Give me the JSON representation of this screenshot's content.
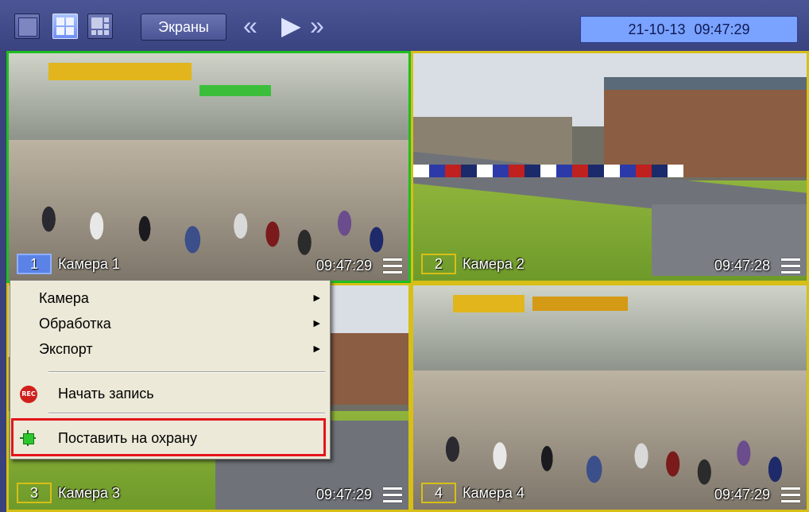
{
  "toolbar": {
    "screens_label": "Экраны",
    "layout_buttons": [
      "layout-1x1-icon",
      "layout-2x2-icon",
      "layout-3x3-icon"
    ],
    "nav_prev_icon": "double-chevron-left-icon",
    "nav_play_icon": "play-icon",
    "nav_next_icon": "double-chevron-right-icon",
    "datetime": "21-10-13  09:47:29"
  },
  "cameras": [
    {
      "number": "1",
      "name": "Камера 1",
      "time": "09:47:29",
      "selected": true
    },
    {
      "number": "2",
      "name": "Камера 2",
      "time": "09:47:28",
      "selected": false
    },
    {
      "number": "3",
      "name": "Камера 3",
      "time": "09:47:29",
      "selected": false
    },
    {
      "number": "4",
      "name": "Камера 4",
      "time": "09:47:29",
      "selected": false
    }
  ],
  "context_menu": {
    "items": [
      {
        "label": "Камера",
        "submenu": true
      },
      {
        "label": "Обработка",
        "submenu": true
      },
      {
        "label": "Экспорт",
        "submenu": true
      },
      {
        "label": "Начать запись",
        "icon": "record-icon",
        "icon_text": "REC"
      },
      {
        "label": "Поставить на охрану",
        "icon": "arm-guard-icon",
        "highlighted": true
      }
    ]
  },
  "colors": {
    "selected_border": "#1fbe1f",
    "camera_border": "#d7bf16",
    "highlight_border": "#e5141a",
    "datetime_bg": "#7aa2ff"
  }
}
